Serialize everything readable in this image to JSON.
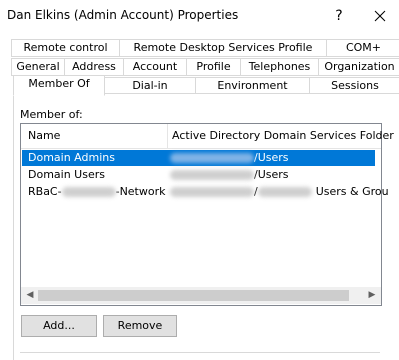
{
  "window": {
    "title": "Dan Elkins (Admin Account) Properties",
    "help_glyph": "?"
  },
  "tabs": {
    "row1": [
      "Remote control",
      "Remote Desktop Services Profile",
      "COM+"
    ],
    "row2": [
      "General",
      "Address",
      "Account",
      "Profile",
      "Telephones",
      "Organization"
    ],
    "row3": [
      "Member Of",
      "Dial-in",
      "Environment",
      "Sessions"
    ],
    "active": "Member Of"
  },
  "member_of": {
    "label": "Member of:",
    "columns": [
      "Name",
      "Active Directory Domain Services Folder"
    ],
    "rows": [
      {
        "name": "Domain Admins",
        "folder_suffix": "/Users",
        "selected": true
      },
      {
        "name": "Domain Users",
        "folder_suffix": "/Users",
        "selected": false
      },
      {
        "name_prefix": "RBaC-",
        "name_suffix": "-Network",
        "folder_sep": "/",
        "folder_suffix": "Users & Grou",
        "selected": false
      }
    ]
  },
  "buttons": {
    "add": "Add...",
    "remove": "Remove"
  },
  "colors": {
    "selection": "#0078d7",
    "tab_border": "#d9d9d9"
  }
}
